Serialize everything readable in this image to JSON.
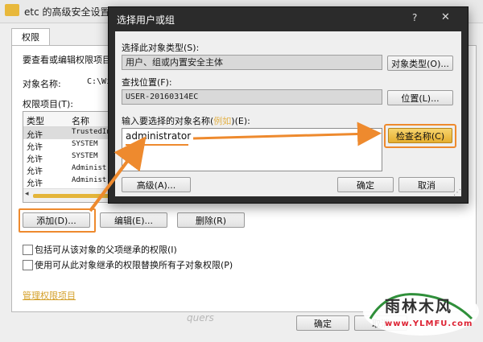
{
  "background_window": {
    "title": "etc 的高级安全设置",
    "tab_label": "权限",
    "instruction": "要查看或编辑权限项目",
    "object_name_label": "对象名称:",
    "object_name_value": "C:\\Wi",
    "permission_entries_label": "权限项目(T):",
    "table": {
      "headers": [
        "类型",
        "名称"
      ],
      "rows": [
        {
          "type": "允许",
          "name": "TrustedIn"
        },
        {
          "type": "允许",
          "name": "SYSTEM"
        },
        {
          "type": "允许",
          "name": "SYSTEM"
        },
        {
          "type": "允许",
          "name": "Administ"
        },
        {
          "type": "允许",
          "name": "Administ"
        }
      ]
    },
    "buttons": {
      "add": "添加(D)...",
      "edit": "编辑(E)...",
      "delete": "删除(R)"
    },
    "checkbox_inherit": "包括可从该对象的父项继承的权限(I)",
    "checkbox_replace": "使用可从此对象继承的权限替换所有子对象权限(P)",
    "manage_link": "管理权限项目",
    "ok": "确定",
    "cancel": "取消"
  },
  "dialog": {
    "title": "选择用户或组",
    "help": "?",
    "close": "✕",
    "object_type_label": "选择此对象类型(S):",
    "object_type_value": "用户、组或内置安全主体",
    "object_type_button": "对象类型(O)...",
    "location_label": "查找位置(F):",
    "location_value": "USER-20160314EC",
    "location_button": "位置(L)...",
    "enter_label_prefix": "输入要选择的对象名称(",
    "enter_label_highlight": "例如",
    "enter_label_suffix": ")(E):",
    "enter_value": "administrator",
    "check_names_button": "检查名称(C)",
    "advanced_button": "高级(A)...",
    "ok": "确定",
    "cancel": "取消"
  },
  "watermark": {
    "signature": "quers",
    "brand_name": "雨林木风",
    "brand_url": "www.YLMFU.com"
  },
  "colors": {
    "highlight_orange": "#ee8a2e",
    "check_button": "#e6ae2e",
    "dialog_frame": "#2b2b2b"
  }
}
